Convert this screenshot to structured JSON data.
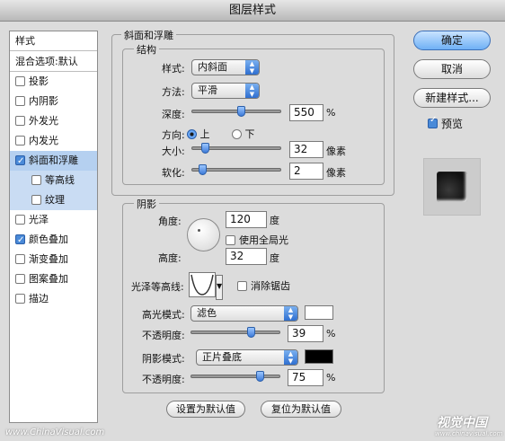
{
  "window_title": "图层样式",
  "styles_list": {
    "header": "样式",
    "blend": "混合选项:默认",
    "items": [
      {
        "label": "投影",
        "checked": false
      },
      {
        "label": "内阴影",
        "checked": false
      },
      {
        "label": "外发光",
        "checked": false
      },
      {
        "label": "内发光",
        "checked": false
      },
      {
        "label": "斜面和浮雕",
        "checked": true
      },
      {
        "label": "等高线",
        "checked": false
      },
      {
        "label": "纹理",
        "checked": false
      },
      {
        "label": "光泽",
        "checked": false
      },
      {
        "label": "颜色叠加",
        "checked": true
      },
      {
        "label": "渐变叠加",
        "checked": false
      },
      {
        "label": "图案叠加",
        "checked": false
      },
      {
        "label": "描边",
        "checked": false
      }
    ]
  },
  "bevel": {
    "title": "斜面和浮雕",
    "structure_title": "结构",
    "style_label": "样式:",
    "style_value": "内斜面",
    "technique_label": "方法:",
    "technique_value": "平滑",
    "depth_label": "深度:",
    "depth_value": "550",
    "percent": "%",
    "direction_label": "方向:",
    "dir_up": "上",
    "dir_down": "下",
    "direction_selected": "上",
    "size_label": "大小:",
    "size_value": "32",
    "px": "像素",
    "soften_label": "软化:",
    "soften_value": "2"
  },
  "shading": {
    "title": "阴影",
    "angle_label": "角度:",
    "angle_value": "120",
    "degree": "度",
    "global_light_label": "使用全局光",
    "global_light_checked": false,
    "altitude_label": "高度:",
    "altitude_value": "32",
    "gloss_label": "光泽等高线:",
    "antialias_label": "消除锯齿",
    "antialias_checked": false,
    "highlight_mode_label": "高光模式:",
    "highlight_mode_value": "滤色",
    "highlight_color": "#ffffff",
    "highlight_opacity_label": "不透明度:",
    "highlight_opacity_value": "39",
    "shadow_mode_label": "阴影模式:",
    "shadow_mode_value": "正片叠底",
    "shadow_color": "#000000",
    "shadow_opacity_label": "不透明度:",
    "shadow_opacity_value": "75",
    "percent": "%"
  },
  "bottom_buttons": {
    "set_default": "设置为默认值",
    "reset_default": "复位为默认值"
  },
  "right_buttons": {
    "ok": "确定",
    "cancel": "取消",
    "new_style": "新建样式...",
    "preview": "预览",
    "preview_checked": true
  },
  "watermark": {
    "left": "www.ChinaVisual.com",
    "logo": "视觉中国",
    "logo_url": "www.chinavisual.com"
  }
}
